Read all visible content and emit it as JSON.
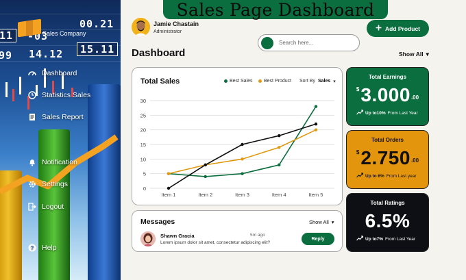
{
  "page_title": "Sales Page Dashboard",
  "sidebar": {
    "company": "Sales Company",
    "tickers": [
      "11",
      "-03",
      "00.21",
      "99",
      "14.12",
      "15.11"
    ],
    "items": [
      {
        "label": "Dashboard",
        "icon": "speedometer-icon"
      },
      {
        "label": "Statistics Sales",
        "icon": "clock-icon"
      },
      {
        "label": "Sales Report",
        "icon": "document-icon"
      },
      {
        "label": "Notification",
        "icon": "bell-icon"
      },
      {
        "label": "Settings",
        "icon": "gear-icon"
      },
      {
        "label": "Logout",
        "icon": "logout-icon"
      },
      {
        "label": "Help",
        "icon": "question-icon"
      }
    ]
  },
  "header": {
    "user_name": "Jamie Chastain",
    "user_role": "Administrator",
    "add_product": "Add Product",
    "search_placeholder": "Search here...",
    "dashboard_title": "Dashboard",
    "show_all": "Show All"
  },
  "sales": {
    "title": "Total Sales",
    "legend": [
      {
        "name": "Best Sales",
        "color": "#0b6e3f"
      },
      {
        "name": "Best Product",
        "color": "#e09a12"
      }
    ],
    "sort_label": "Sort By",
    "sort_value": "Sales"
  },
  "chart_data": {
    "type": "line",
    "categories": [
      "Item 1",
      "Item 2",
      "Item 3",
      "Item 4",
      "Item 5"
    ],
    "yticks": [
      0,
      5,
      10,
      15,
      20,
      25,
      30
    ],
    "ylim": [
      0,
      30
    ],
    "grid": true,
    "legend_position": "top-right",
    "series": [
      {
        "name": "Best Sales",
        "color": "#0b6e3f",
        "values": [
          5,
          4,
          5,
          8,
          28
        ]
      },
      {
        "name": "Best Product",
        "color": "#e09a12",
        "values": [
          5,
          8,
          10,
          14,
          20
        ]
      },
      {
        "color": "#111111",
        "values": [
          0,
          8,
          15,
          18,
          22
        ]
      }
    ]
  },
  "messages": {
    "title": "Messages",
    "show_all": "Show All",
    "items": [
      {
        "name": "Shawn Gracia",
        "time": "5m ago",
        "text": "Lorem ipsum dolor sit amet, consectetur adipiscing elit?",
        "reply": "Reply"
      }
    ]
  },
  "stats": [
    {
      "label": "Total Earnings",
      "currency": "$",
      "value": "3.000",
      "cents": ".00",
      "change": "Up to10%",
      "suffix": "From Last Year",
      "color": "#0b6e3f"
    },
    {
      "label": "Total Orders",
      "currency": "$",
      "value": "2.750",
      "cents": ".00",
      "change": "Up to 6%",
      "suffix": "From Last year",
      "color": "#e4950e"
    },
    {
      "label": "Total Ratings",
      "currency": "",
      "value": "6.5%",
      "cents": "",
      "change": "Up to7%",
      "suffix": "From Last Year",
      "color": "#0d0f14"
    }
  ]
}
